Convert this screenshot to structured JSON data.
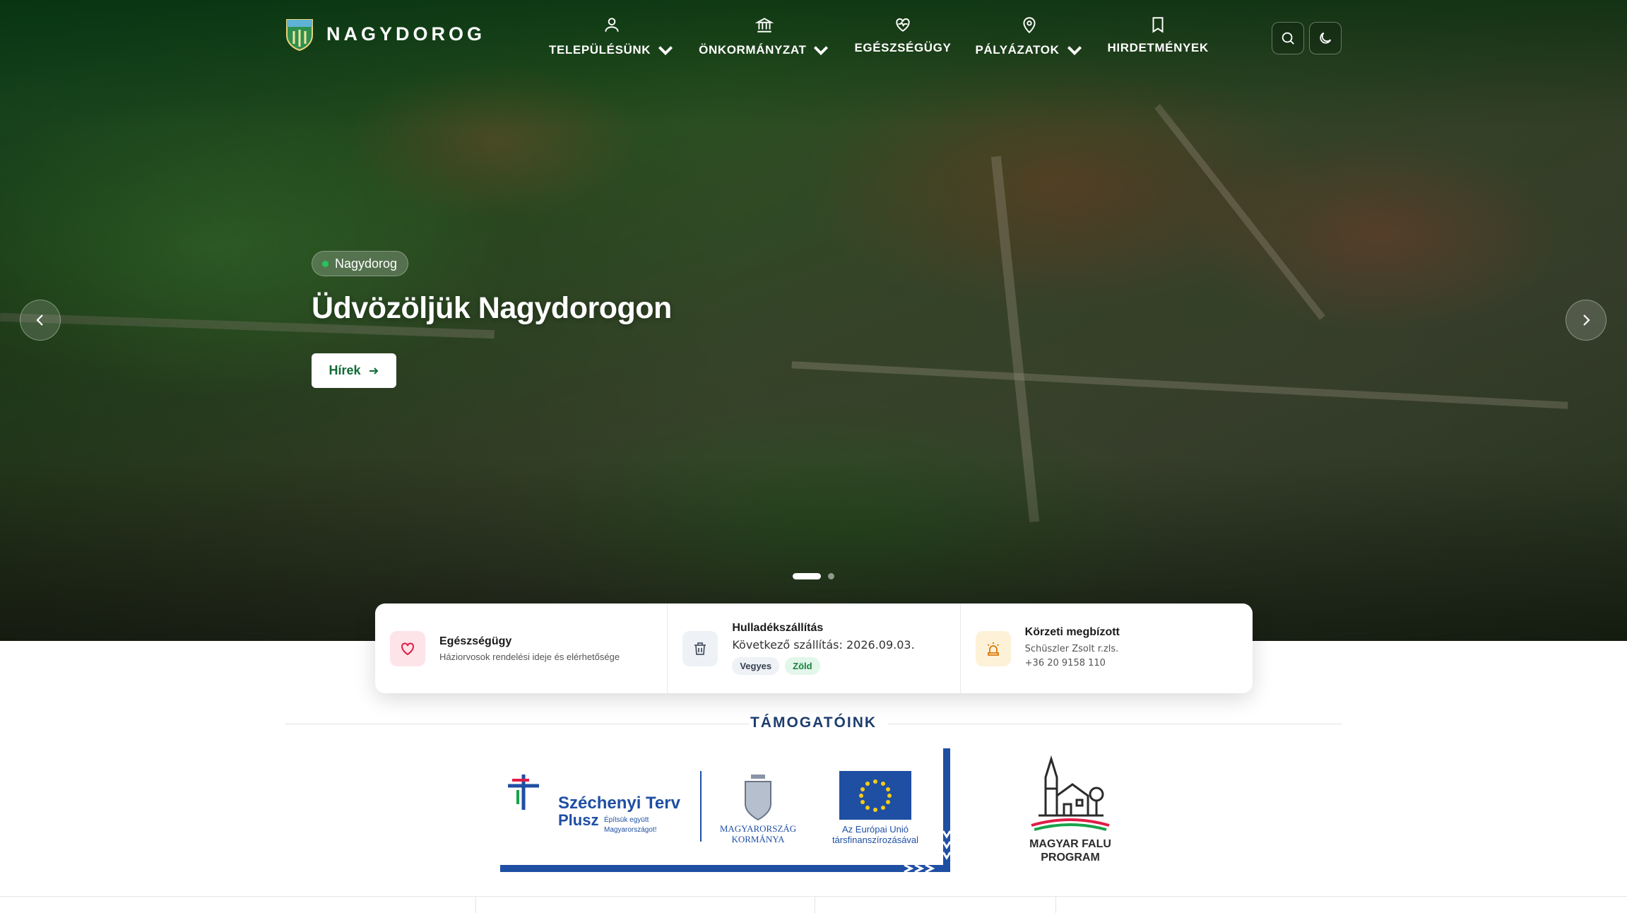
{
  "brand": {
    "name": "NAGYDOROG"
  },
  "nav": {
    "items": [
      {
        "label": "TELEPÜLÉSÜNK",
        "icon": "user-icon",
        "dropdown": true
      },
      {
        "label": "ÖNKORMÁNYZAT",
        "icon": "building-icon",
        "dropdown": true
      },
      {
        "label": "EGÉSZSÉGÜGY",
        "icon": "heart-pulse-icon",
        "dropdown": false
      },
      {
        "label": "PÁLYÁZATOK",
        "icon": "map-pin-icon",
        "dropdown": true
      },
      {
        "label": "HIRDETMÉNYEK",
        "icon": "bookmark-icon",
        "dropdown": false
      }
    ]
  },
  "hero": {
    "tag": "Nagydorog",
    "title": "Üdvözöljük Nagydorogon",
    "button_label": "Hírek",
    "slide_count": 2,
    "active_slide": 1
  },
  "cards": {
    "health": {
      "title": "Egészségügy",
      "subtitle": "Háziorvosok rendelési ideje és elérhetősége",
      "icon": "heart-icon",
      "color": "#e11d48"
    },
    "waste": {
      "title": "Hulladékszállítás",
      "subtitle": "Következő szállítás: 2026.09.03.",
      "icon": "trash-icon",
      "badges": [
        "Vegyes",
        "Zöld"
      ]
    },
    "officer": {
      "title": "Körzeti megbízott",
      "name": "Schüszler Zsolt r.zls.",
      "phone": "+36 20 9158 110",
      "icon": "siren-icon",
      "color": "#d97706"
    }
  },
  "sponsors": {
    "title": "TÁMOGATÓINK",
    "szechenyi": {
      "line1": "Széchenyi Terv",
      "line2": "Plusz",
      "tag1": "Építsük együtt",
      "tag2": "Magyarországot!"
    },
    "government": {
      "line1": "MAGYARORSZÁG",
      "line2": "KORMÁNYA"
    },
    "eu": {
      "line1": "Az Európai Unió",
      "line2": "társfinanszírozásával"
    },
    "falu": {
      "line1": "MAGYAR FALU",
      "line2": "PROGRAM"
    }
  },
  "colors": {
    "brand_green": "#0f6b36",
    "navy": "#1d3d6e",
    "sponsor_blue": "#1f4fa3"
  }
}
